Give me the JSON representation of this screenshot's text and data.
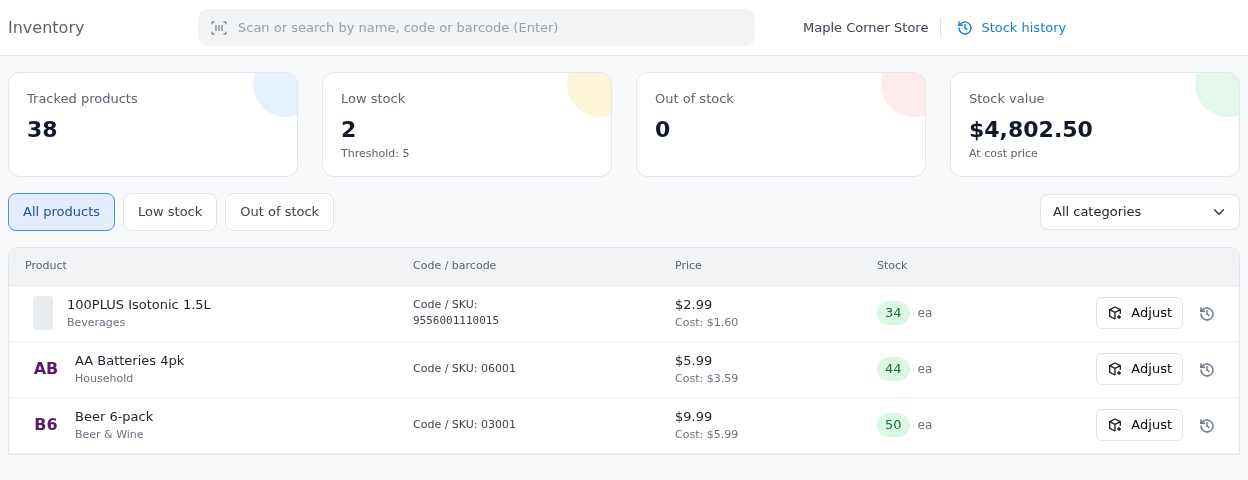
{
  "header": {
    "title": "Inventory",
    "search": {
      "placeholder": "Scan or search by name, code or barcode (Enter)"
    },
    "store": "Maple Corner Store",
    "history_link": "Stock history"
  },
  "stats": [
    {
      "label": "Tracked products",
      "value": "38",
      "color": "#e7f1fe"
    },
    {
      "label": "Low stock",
      "value": "2",
      "note": "Threshold: 5",
      "color": "#fef6d8"
    },
    {
      "label": "Out of stock",
      "value": "0",
      "color": "#fdeaea"
    },
    {
      "label": "Stock value",
      "value": "$4,802.50",
      "note": "At cost price",
      "color": "#e3f8ea"
    }
  ],
  "filters": [
    {
      "label": "All products",
      "selected": true
    },
    {
      "label": "Low stock",
      "selected": false
    },
    {
      "label": "Out of stock",
      "selected": false
    }
  ],
  "category_select": {
    "value": "All categories"
  },
  "table": {
    "columns": [
      "Product",
      "Code / barcode",
      "Price",
      "Stock"
    ],
    "rows": [
      {
        "thumb": {
          "kind": "photo"
        },
        "name": "100PLUS Isotonic 1.5L",
        "category": "Beverages",
        "code": {
          "kind": "barcode",
          "label": "Code / SKU:",
          "value": "9556001110015"
        },
        "price": "$2.99",
        "cost": "Cost: $1.60",
        "stock": "34",
        "unit": "ea",
        "action": "Adjust"
      },
      {
        "thumb": {
          "kind": "initials",
          "text": "AB"
        },
        "name": "AA Batteries 4pk",
        "category": "Household",
        "code": {
          "kind": "sku",
          "text": "Code / SKU: 06001"
        },
        "price": "$5.99",
        "cost": "Cost: $3.59",
        "stock": "44",
        "unit": "ea",
        "action": "Adjust"
      },
      {
        "thumb": {
          "kind": "initials",
          "text": "B6"
        },
        "name": "Beer 6-pack",
        "category": "Beer & Wine",
        "code": {
          "kind": "sku",
          "text": "Code / SKU: 03001"
        },
        "price": "$9.99",
        "cost": "Cost: $5.99",
        "stock": "50",
        "unit": "ea",
        "action": "Adjust"
      }
    ]
  }
}
